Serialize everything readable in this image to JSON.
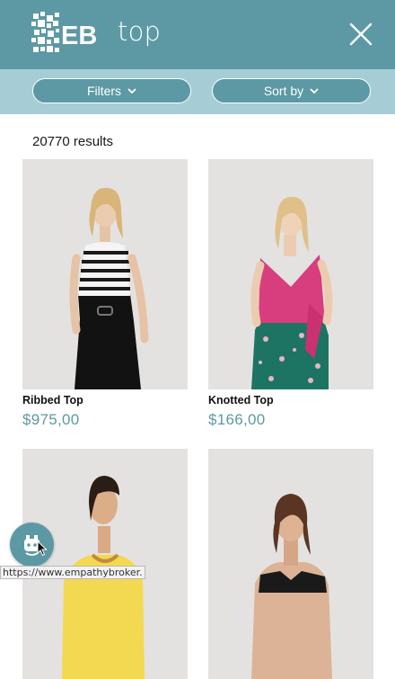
{
  "header": {
    "logo_text": "EB",
    "query": "top",
    "close_icon": "close-icon"
  },
  "toolbar": {
    "filters_label": "Filters",
    "sort_label": "Sort by",
    "chevron_icon": "chevron-down-icon"
  },
  "results": {
    "count": "20770 results",
    "items": [
      {
        "title": "Ribbed Top",
        "price": "$975,00"
      },
      {
        "title": "Knotted Top",
        "price": "$166,00"
      },
      {
        "title": "",
        "price": ""
      },
      {
        "title": "",
        "price": ""
      }
    ]
  },
  "fab": {
    "icon": "empathy-assistant-icon"
  },
  "status_bar": {
    "url": "https://www.empathybroker."
  },
  "colors": {
    "brand": "#5c99a4",
    "toolbar_bg": "#a6cdd5",
    "price": "#5c99a4"
  }
}
